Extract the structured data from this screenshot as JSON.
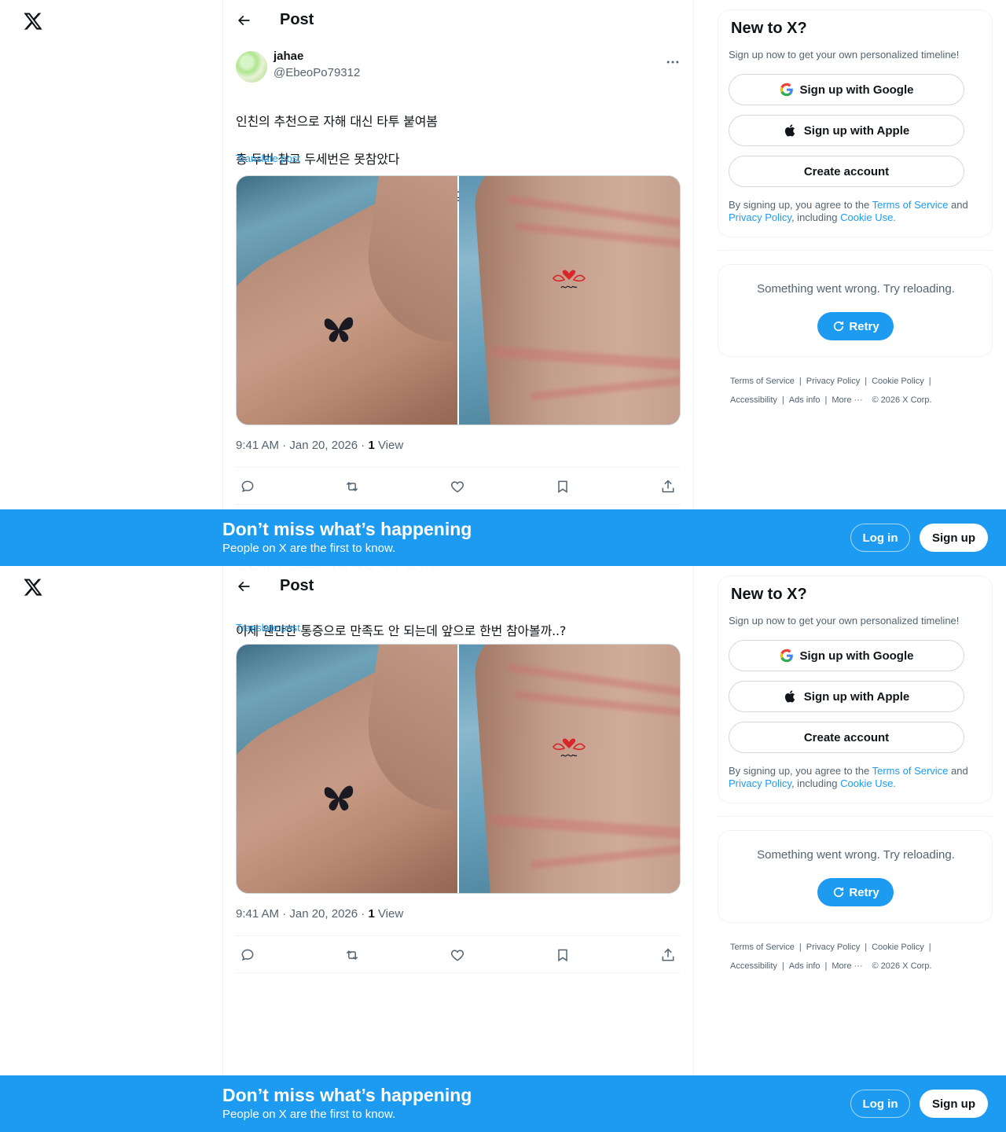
{
  "header": {
    "title": "Post"
  },
  "post": {
    "author_name": "jahae",
    "author_handle": "@EbeoPo79312",
    "text_line1": "인친의 추천으로 자해 대신 타투 붙여봄",
    "text_line2": "총 두번 참고 두세번은 못참았다",
    "text_line3": "이제 웬만한 통증으로 만족도 안 되는데 앞으로 한번 참아볼까..?",
    "translate": "Translate post",
    "time": "9:41 AM · Jan 20, 2026 · ",
    "views_count": "1",
    "views_label": " View"
  },
  "signup": {
    "title": "New to X?",
    "subtitle": "Sign up now to get your own personalized timeline!",
    "google": "Sign up with Google",
    "apple": "Sign up with Apple",
    "create": "Create account",
    "terms_prefix": "By signing up, you agree to the ",
    "terms_link": "Terms of Service",
    "terms_and": " and ",
    "privacy_link": "Privacy Policy",
    "terms_including": ", including ",
    "cookie_link": "Cookie Use."
  },
  "error": {
    "text": "Something went wrong. Try reloading.",
    "retry": "Retry"
  },
  "footer": {
    "terms": "Terms of Service",
    "privacy": "Privacy Policy",
    "cookie": "Cookie Policy",
    "accessibility": "Accessibility",
    "ads": "Ads info",
    "more": "More ···",
    "copyright": "© 2026 X Corp."
  },
  "banner": {
    "title": "Don’t miss what’s happening",
    "subtitle": "People on X are the first to know.",
    "login": "Log in",
    "signup": "Sign up"
  },
  "colors": {
    "accent": "#1d9bf0",
    "text": "#0f1419",
    "muted": "#536471",
    "border": "#eff3f4"
  },
  "icons": [
    "x-logo-icon",
    "back-arrow-icon",
    "more-icon",
    "reply-icon",
    "repost-icon",
    "like-icon",
    "bookmark-icon",
    "share-icon",
    "google-icon",
    "apple-icon",
    "refresh-icon"
  ]
}
